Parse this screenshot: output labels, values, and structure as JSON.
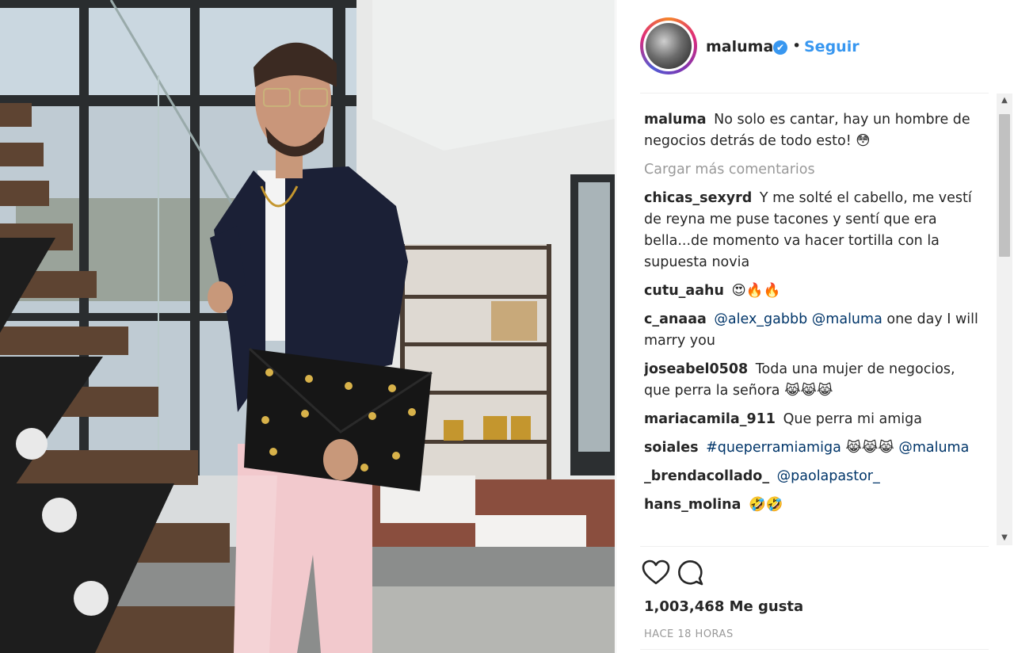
{
  "post": {
    "username": "maluma",
    "follow_label": "Seguir",
    "dot": "•",
    "verified_icon": "✔",
    "caption_user": "maluma",
    "caption_text": "No solo es cantar, hay un hombre de negocios detrás de todo esto! 😳",
    "load_more": "Cargar más comentarios",
    "likes": "1,003,468 Me gusta",
    "time": "HACE 18 HORAS"
  },
  "comments": [
    {
      "user": "chicas_sexyrd",
      "text": "Y me solté el cabello, me vestí de reyna me puse tacones y sentí que era bella...de momento va hacer tortilla con la supuesta novia"
    },
    {
      "user": "cutu_aahu",
      "text": "😍🔥🔥"
    },
    {
      "user": "c_anaaa",
      "mention1": "@alex_gabbb",
      "mention2": "@maluma",
      "text": "one day I will marry you"
    },
    {
      "user": "joseabel0508",
      "text": "Toda una mujer de negocios, que perra la señora 😹😹😹"
    },
    {
      "user": "mariacamila_911",
      "text": "Que perra mi amiga"
    },
    {
      "user": "soiales",
      "hashtag": "#queperramiamiga",
      "text": "😹😹😹",
      "mention": "@maluma"
    },
    {
      "user": "_brendacollado_",
      "mention": "@paolapastor_"
    },
    {
      "user": "hans_molina",
      "text": "🤣🤣"
    }
  ],
  "icons": {
    "heart": "heart-icon",
    "comment": "comment-icon",
    "scroll_up": "▲",
    "scroll_down": "▼"
  },
  "colors": {
    "link": "#3897f0",
    "mention": "#003569",
    "muted": "#999999"
  }
}
